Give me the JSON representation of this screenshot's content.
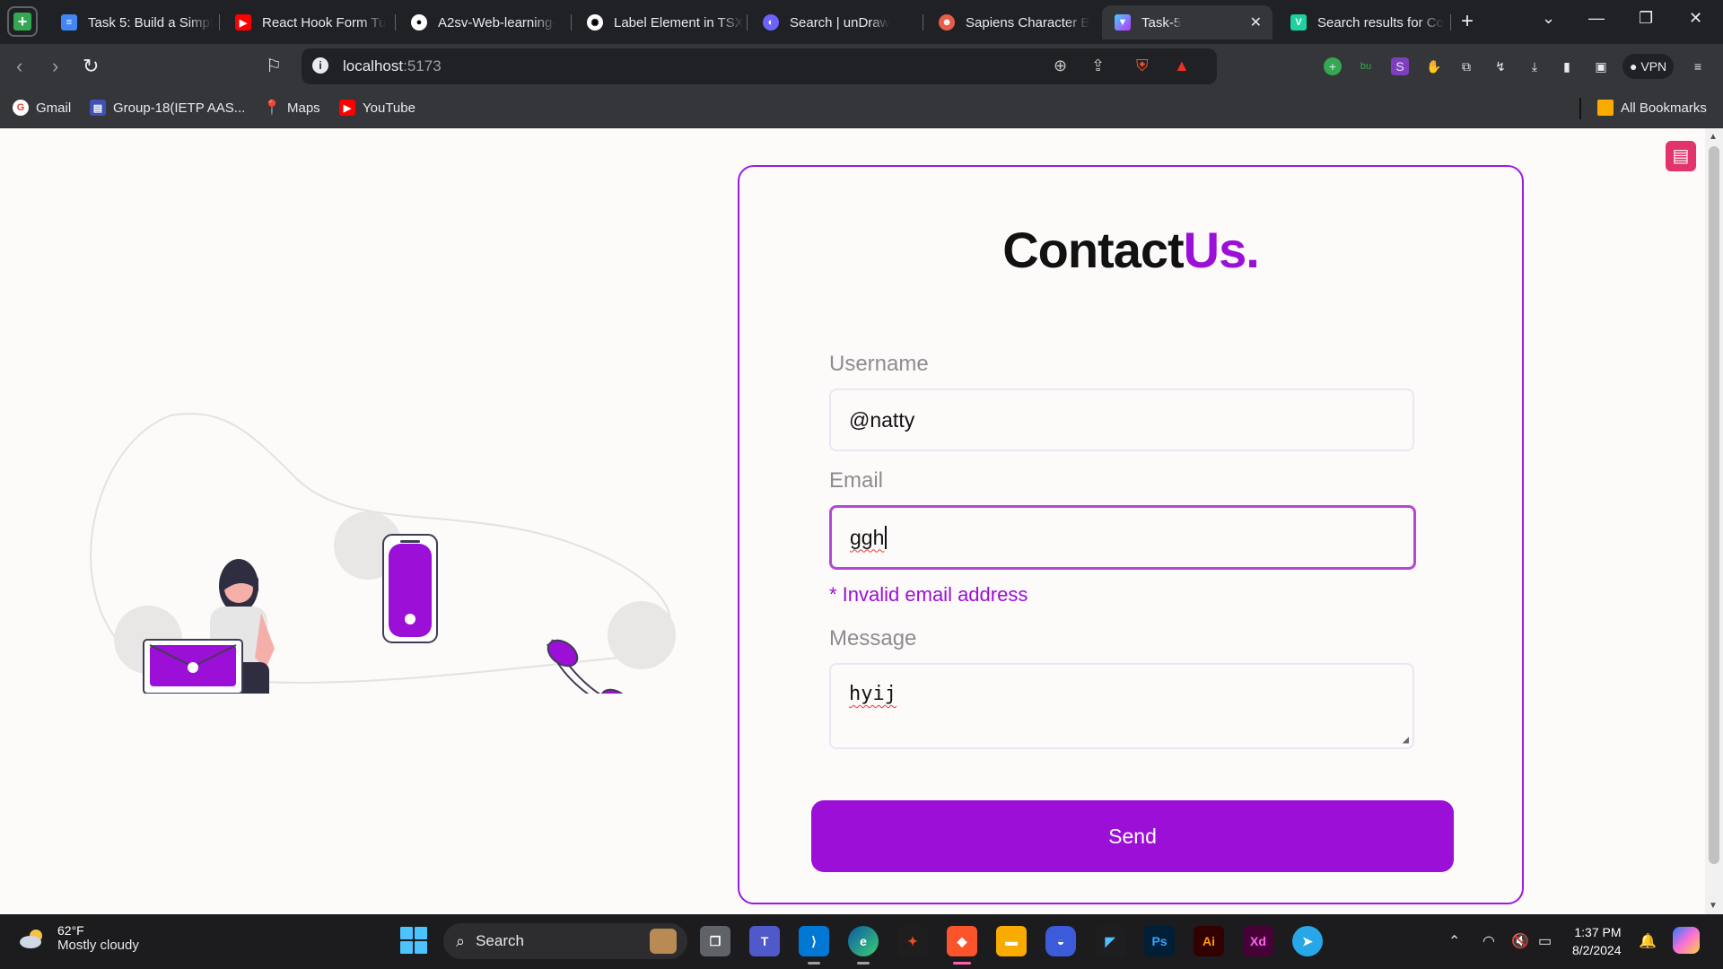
{
  "browser": {
    "tabs": [
      {
        "label": "Task 5: Build a Simpl",
        "icon": "google-docs-icon",
        "color": "#4285f4"
      },
      {
        "label": "React Hook Form Tu",
        "icon": "youtube-icon",
        "color": "#ff0000"
      },
      {
        "label": "A2sv-Web-learning-",
        "icon": "github-icon",
        "color": "#ffffff"
      },
      {
        "label": "Label Element in TSX",
        "icon": "chatgpt-icon",
        "color": "#ffffff"
      },
      {
        "label": "Search | unDraw",
        "icon": "undraw-icon",
        "color": "#6c63ff"
      },
      {
        "label": "Sapiens Character B",
        "icon": "sapiens-icon",
        "color": "#e85d4a"
      },
      {
        "label": "Task-5",
        "icon": "vite-icon",
        "color": "#a259ff"
      },
      {
        "label": "Search results for Co",
        "icon": "vuetify-icon",
        "color": "#1dd1a1"
      }
    ],
    "active_tab": "Task-5",
    "url_host": "localhost",
    "url_port": ":5173",
    "vpn_label": "VPN",
    "bookmarks": [
      {
        "label": "Gmail",
        "icon": "google-icon"
      },
      {
        "label": "Group-18(IETP AAS...",
        "icon": "forms-icon"
      },
      {
        "label": "Maps",
        "icon": "maps-icon"
      },
      {
        "label": "YouTube",
        "icon": "youtube-icon"
      }
    ],
    "all_bookmarks": "All Bookmarks"
  },
  "page": {
    "title_main": "Contact",
    "title_accent": "Us.",
    "accent_color": "#9b0fd6",
    "username_label": "Username",
    "username_value": "@natty",
    "email_label": "Email",
    "email_value": "ggh",
    "email_error": "* Invalid email address",
    "message_label": "Message",
    "message_value": "hyij",
    "send_label": "Send"
  },
  "taskbar": {
    "temperature": "62°F",
    "weather": "Mostly cloudy",
    "search_label": "Search",
    "time": "1:37 PM",
    "date": "8/2/2024",
    "pinned_apps": [
      "task-view-icon",
      "teams-icon",
      "vscode-icon",
      "edge-icon",
      "figma-icon",
      "brave-icon",
      "file-explorer-icon",
      "app-icon",
      "framer-icon",
      "photoshop-icon",
      "illustrator-icon",
      "xd-icon",
      "telegram-icon"
    ]
  }
}
